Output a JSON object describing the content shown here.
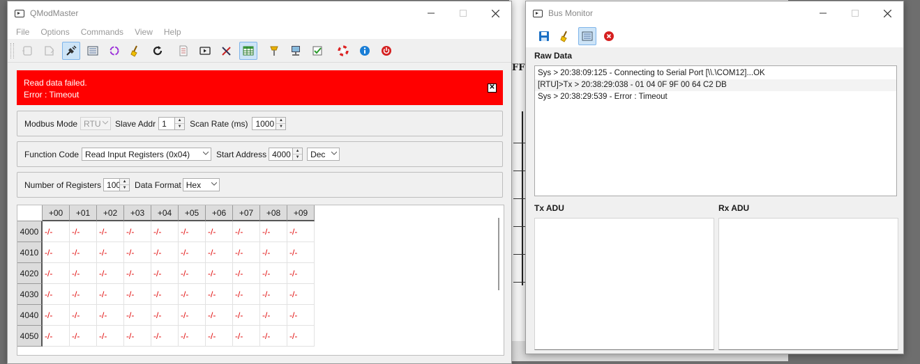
{
  "background": {
    "ff_text": "FF"
  },
  "qmodmaster": {
    "title": "QModMaster",
    "menu": [
      "File",
      "Options",
      "Commands",
      "View",
      "Help"
    ],
    "toolbar_icons": [
      "connect-icon",
      "disconnect-icon",
      "serial-port-icon",
      "raw-data-icon",
      "scan-icon",
      "clear-icon",
      "refresh-icon",
      "log-icon",
      "bus-monitor-icon",
      "tools-icon",
      "table-icon",
      "plugin-icon",
      "network-icon",
      "checkbox-icon",
      "help-lifebuoy-icon",
      "info-icon",
      "exit-icon"
    ],
    "error": {
      "line1": "Read data failed.",
      "line2": "Error : Timeout",
      "close": "✕"
    },
    "modbus_mode": {
      "label": "Modbus Mode",
      "value": "RTU"
    },
    "slave_addr": {
      "label": "Slave Addr",
      "value": "1"
    },
    "scan_rate": {
      "label": "Scan Rate (ms)",
      "value": "1000"
    },
    "function_code": {
      "label": "Function Code",
      "value": "Read Input Registers (0x04)"
    },
    "start_address": {
      "label": "Start Address",
      "value": "4000",
      "format": "Dec"
    },
    "num_registers": {
      "label": "Number of Registers",
      "value": "100"
    },
    "data_format": {
      "label": "Data Format",
      "value": "Hex"
    },
    "table": {
      "columns": [
        "+00",
        "+01",
        "+02",
        "+03",
        "+04",
        "+05",
        "+06",
        "+07",
        "+08",
        "+09"
      ],
      "rows": [
        "4000",
        "4010",
        "4020",
        "4030",
        "4040",
        "4050"
      ],
      "cell_value": "-/-"
    }
  },
  "bus_monitor": {
    "title": "Bus Monitor",
    "toolbar_icons": [
      "save-icon",
      "clear-icon",
      "raw-data-icon",
      "close-icon"
    ],
    "raw_data_label": "Raw Data",
    "raw_lines": [
      "Sys > 20:38:09:125 - Connecting to Serial Port [\\\\.\\COM12]...OK",
      "[RTU]>Tx > 20:38:29:038 - 01  04  0F  9F  00  64  C2  DB",
      "Sys > 20:38:29:539 - Error : Timeout"
    ],
    "tx_adu_label": "Tx ADU",
    "rx_adu_label": "Rx ADU"
  }
}
